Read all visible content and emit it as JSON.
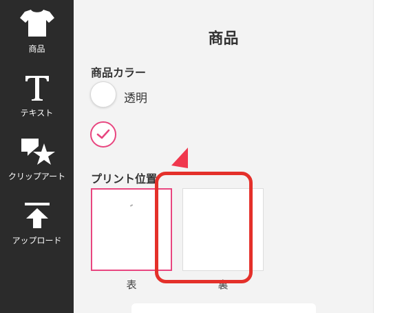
{
  "sidebar": {
    "items": [
      {
        "label": "商品",
        "icon": "tshirt-icon"
      },
      {
        "label": "テキスト",
        "icon": "text-icon"
      },
      {
        "label": "クリップアート",
        "icon": "clipart-icon"
      },
      {
        "label": "アップロード",
        "icon": "upload-icon"
      }
    ]
  },
  "panel": {
    "title": "商品",
    "color_section": {
      "label": "商品カラー",
      "options": [
        {
          "label": "透明"
        }
      ]
    },
    "print_section": {
      "label": "プリント位置",
      "positions": [
        {
          "label": "表",
          "selected": true
        },
        {
          "label": "裏",
          "selected": false
        }
      ]
    }
  },
  "colors": {
    "accent": "#e8457f",
    "highlight": "#e4302a",
    "sidebar_bg": "#2b2b2b",
    "panel_bg": "#f3f3f3"
  }
}
